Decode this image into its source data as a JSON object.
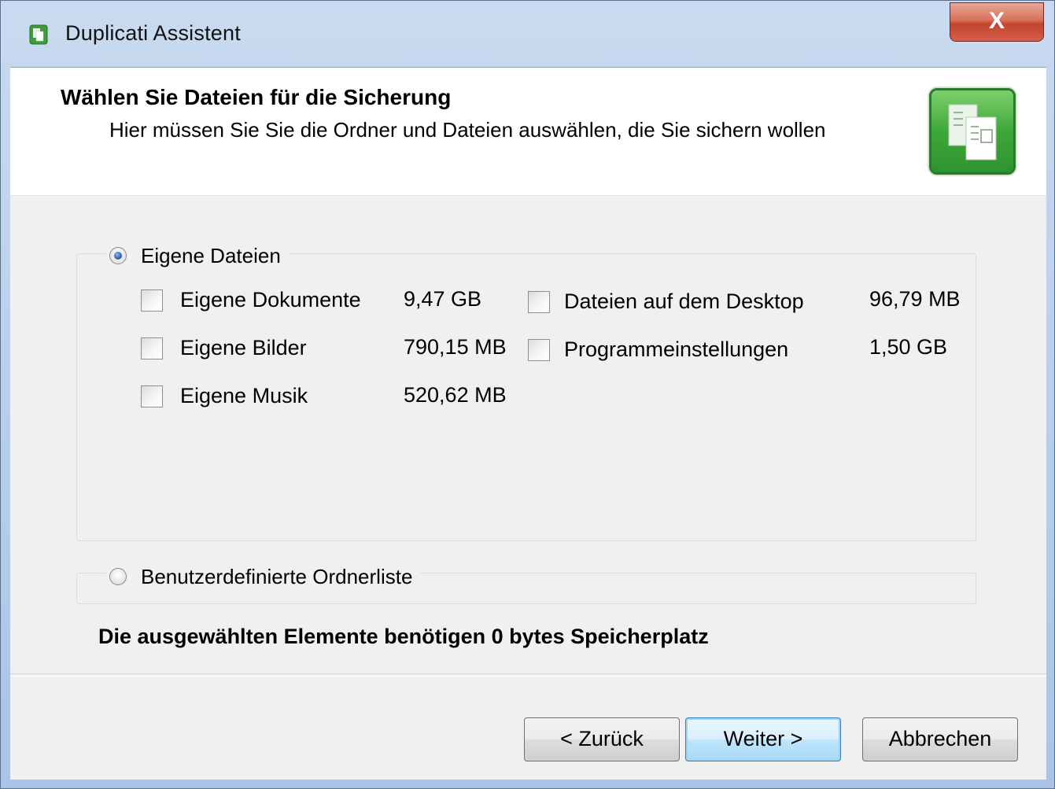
{
  "window": {
    "title": "Duplicati Assistent",
    "close_label": "X"
  },
  "header": {
    "title": "Wählen Sie Dateien für die Sicherung",
    "subtitle": "Hier müssen Sie Sie die Ordner und Dateien auswählen, die Sie sichern wollen"
  },
  "options": {
    "own_files": {
      "label": "Eigene Dateien",
      "selected": true
    },
    "custom_list": {
      "label": "Benutzerdefinierte Ordnerliste",
      "selected": false
    }
  },
  "folders": [
    {
      "label": "Eigene Dokumente",
      "size": "9,47 GB",
      "checked": false
    },
    {
      "label": "Eigene Bilder",
      "size": "790,15 MB",
      "checked": false
    },
    {
      "label": "Eigene Musik",
      "size": "520,62 MB",
      "checked": false
    },
    {
      "label": "Dateien auf dem Desktop",
      "size": "96,79 MB",
      "checked": false
    },
    {
      "label": "Programmeinstellungen",
      "size": "1,50 GB",
      "checked": false
    }
  ],
  "summary": "Die ausgewählten Elemente benötigen 0 bytes Speicherplatz",
  "buttons": {
    "back": "< Zurück",
    "next": "Weiter >",
    "cancel": "Abbrechen"
  }
}
